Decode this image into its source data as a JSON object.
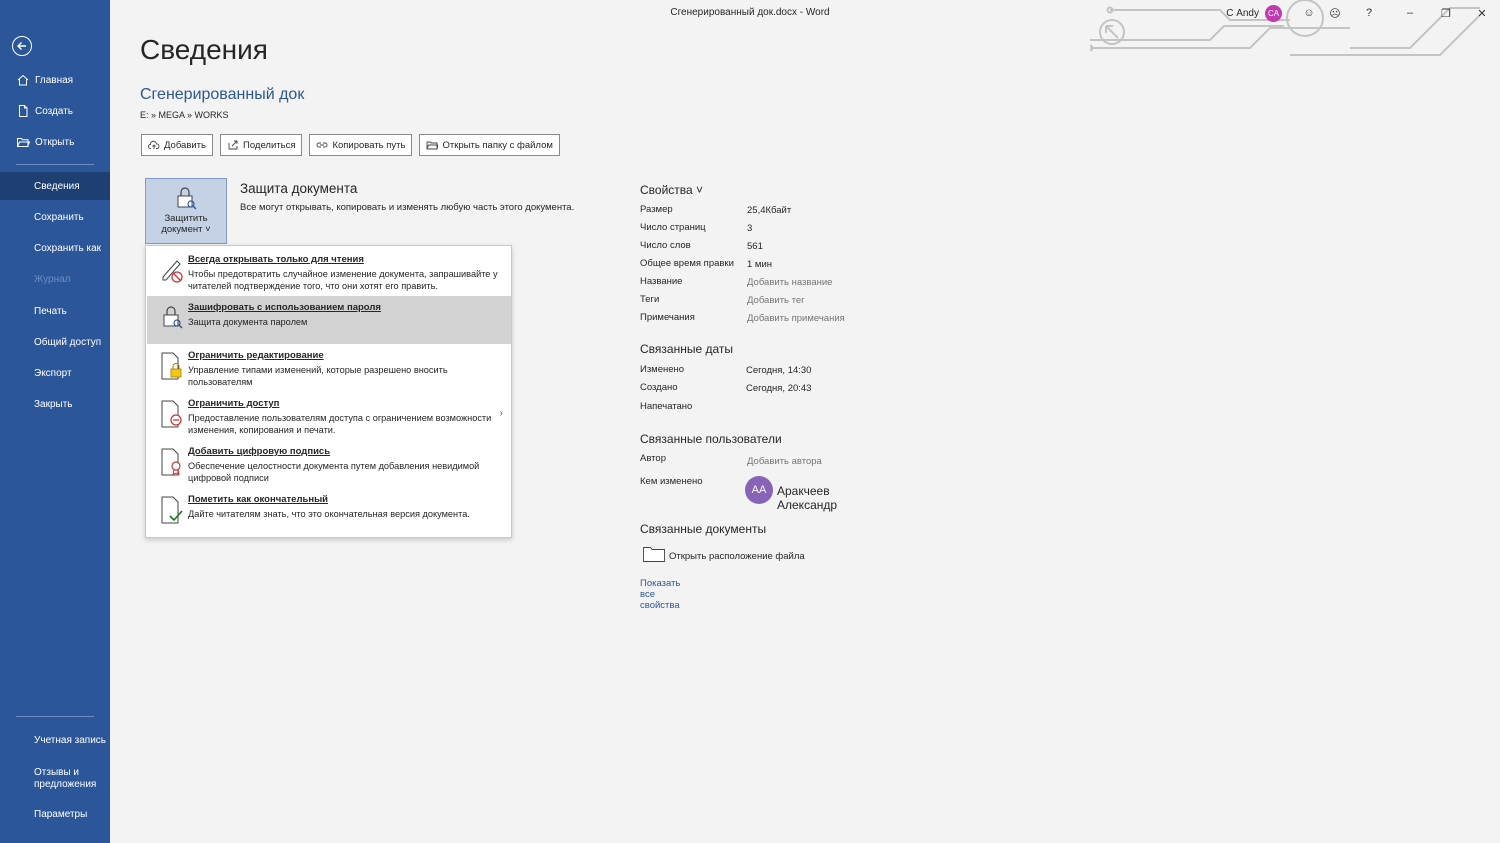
{
  "window": {
    "title": "Сгенерированный док.docx  -  Word"
  },
  "titlebar": {
    "user": "С Andy",
    "avatar": "CA",
    "smile": "☺",
    "frown": "☹",
    "help": "?",
    "minimize": "–",
    "restore": "❐",
    "close": "✕"
  },
  "sidebar": {
    "items": [
      {
        "label": "Главная",
        "icon": "home-icon"
      },
      {
        "label": "Создать",
        "icon": "new-doc-icon"
      },
      {
        "label": "Открыть",
        "icon": "folder-open-icon"
      },
      {
        "label": "Сведения"
      },
      {
        "label": "Сохранить"
      },
      {
        "label": "Сохранить как"
      },
      {
        "label": "Журнал"
      },
      {
        "label": "Печать"
      },
      {
        "label": "Общий доступ"
      },
      {
        "label": "Экспорт"
      },
      {
        "label": "Закрыть"
      }
    ],
    "bottom": [
      {
        "label": "Учетная запись"
      },
      {
        "label": "Отзывы и предложения"
      },
      {
        "label": "Параметры"
      }
    ]
  },
  "main": {
    "title": "Сведения",
    "doc_name": "Сгенерированный док",
    "path": "E: » MEGA » WORKS",
    "actions": [
      {
        "label": "Добавить",
        "icon": "upload-cloud-icon"
      },
      {
        "label": "Поделиться",
        "icon": "share-icon"
      },
      {
        "label": "Копировать путь",
        "icon": "link-icon"
      },
      {
        "label": "Открыть папку с файлом",
        "icon": "folder-icon"
      }
    ],
    "protect": {
      "button_line1": "Защитить",
      "button_line2": "документ ˅",
      "title": "Защита документа",
      "desc": "Все могут открывать, копировать и изменять любую часть этого документа."
    },
    "menu": [
      {
        "title": "Всегда открывать только для чтения",
        "desc": "Чтобы предотвратить случайное изменение документа, запрашивайте у читателей подтверждение того, что они хотят его править.",
        "icon": "pencil-no-icon"
      },
      {
        "title": "Зашифровать с использованием пароля",
        "desc": "Защита документа паролем",
        "icon": "lock-key-icon"
      },
      {
        "title": "Ограничить редактирование",
        "desc": "Управление типами изменений, которые разрешено вносить пользователям",
        "icon": "doc-lock-icon"
      },
      {
        "title": "Ограничить доступ",
        "desc": "Предоставление пользователям доступа с ограничением возможности изменения, копирования и печати.",
        "icon": "doc-restrict-icon",
        "arrow": "›"
      },
      {
        "title": "Добавить цифровую подпись",
        "desc": "Обеспечение целостности документа путем добавления невидимой цифровой подписи",
        "icon": "doc-ribbon-icon"
      },
      {
        "title": "Пометить как окончательный",
        "desc": "Дайте читателям знать, что это окончательная версия документа.",
        "icon": "doc-check-icon"
      }
    ]
  },
  "properties": {
    "head": "Свойства ˅",
    "rows": [
      {
        "label": "Размер",
        "value": "25,4Кбайт"
      },
      {
        "label": "Число страниц",
        "value": "3"
      },
      {
        "label": "Число слов",
        "value": "561"
      },
      {
        "label": "Общее время правки",
        "value": "1 мин"
      },
      {
        "label": "Название",
        "value": "Добавить название"
      },
      {
        "label": "Теги",
        "value": "Добавить тег"
      },
      {
        "label": "Примечания",
        "value": "Добавить примечания"
      }
    ],
    "dates_head": "Связанные даты",
    "dates": [
      {
        "label": "Изменено",
        "value": "Сегодня, 14:30"
      },
      {
        "label": "Создано",
        "value": "Сегодня, 20:43"
      },
      {
        "label": "Напечатано",
        "value": ""
      }
    ],
    "people_head": "Связанные пользователи",
    "author_label": "Автор",
    "author_value": "Добавить автора",
    "modified_by_label": "Кем изменено",
    "modified_by_avatar": "АА",
    "modified_by_name": "Аракчеев Александр",
    "docs_head": "Связанные документы",
    "open_location": "Открыть расположение файла",
    "show_all": "Показать все свойства"
  }
}
